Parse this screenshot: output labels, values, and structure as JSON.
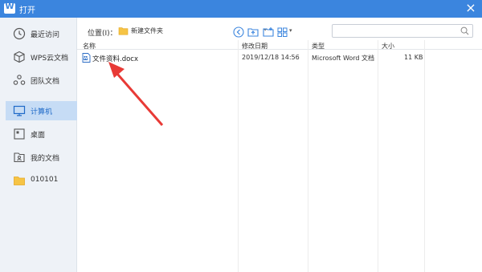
{
  "window": {
    "title": "打开",
    "logo_letter": "W"
  },
  "sidebar": {
    "items": [
      {
        "label": "最近访问",
        "icon": "clock-icon"
      },
      {
        "label": "WPS云文档",
        "icon": "cube-icon"
      },
      {
        "label": "团队文档",
        "icon": "team-icon"
      },
      {
        "label": "计算机",
        "icon": "monitor-icon",
        "active": true
      },
      {
        "label": "桌面",
        "icon": "desktop-icon"
      },
      {
        "label": "我的文档",
        "icon": "my-documents-icon"
      },
      {
        "label": "010101",
        "icon": "folder-icon"
      }
    ]
  },
  "toolbar": {
    "location_label": "位置(I)：",
    "location_value": "新建文件夹"
  },
  "columns": {
    "name": "名称",
    "modified": "修改日期",
    "type": "类型",
    "size": "大小"
  },
  "files": [
    {
      "name": "文件资料.docx",
      "modified": "2019/12/18 14:56",
      "type": "Microsoft Word 文档",
      "size": "11 KB"
    }
  ],
  "colors": {
    "titlebar": "#3b85de",
    "sidebar": "#eef2f7",
    "active": "#c6dcf5",
    "arrow": "#e83a36"
  }
}
